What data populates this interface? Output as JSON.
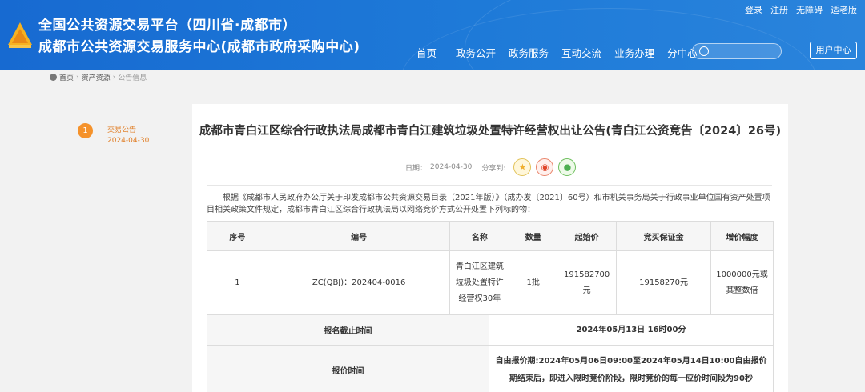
{
  "header": {
    "title_line1": "全国公共资源交易平台（四川省·成都市）",
    "title_line2": "成都市公共资源交易服务中心(成都市政府采购中心)",
    "top_links": [
      "登录",
      "注册",
      "无障碍",
      "适老版"
    ],
    "nav": [
      "首页",
      "政务公开",
      "政务服务",
      "互动交流",
      "业务办理",
      "分中心"
    ],
    "search_placeholder": "",
    "user_center": "用户中心",
    "brand_color": "#1b6ed0"
  },
  "breadcrumb": [
    "首页",
    "资产资源",
    "公告信息"
  ],
  "timeline": {
    "step": "1",
    "label": "交易公告",
    "date": "2024-04-30",
    "accent_color": "#f5922b"
  },
  "article": {
    "title": "成都市青白江区综合行政执法局成都市青白江建筑垃圾处置特许经营权出让公告(青白江公资竞告〔2024〕26号)",
    "date_label": "日期：",
    "date": "2024-04-30",
    "share_label": "分享到:",
    "share_icons": [
      "qzone-icon",
      "weibo-icon",
      "wechat-icon"
    ],
    "intro": "根据《成都市人民政府办公厅关于印发成都市公共资源交易目录（2021年版）》（成办发〔2021〕60号）和市机关事务局关于行政事业单位国有资产处置项目相关政策文件规定，成都市青白江区综合行政执法局以网络竞价方式公开处置下列标的物：",
    "table": {
      "headers": [
        "序号",
        "编号",
        "名称",
        "数量",
        "起始价",
        "竞买保证金",
        "增价幅度"
      ],
      "rows": [
        [
          "1",
          "ZC(QBJ)：202404-0016",
          "青白江区建筑垃圾处置特许经营权30年",
          "1批",
          "191582700元",
          "19158270元",
          "1000000元或其整数倍"
        ]
      ]
    },
    "times": {
      "deadline_label": "报名截止时间",
      "deadline_value": "2024年05月13日 16时00分",
      "bid_label": "报价时间",
      "bid_value": "自由报价期:2024年05月06日09:00至2024年05月14日10:00自由报价期结束后，即进入限时竞价阶段，限时竞价的每一应价时间段为90秒"
    }
  }
}
